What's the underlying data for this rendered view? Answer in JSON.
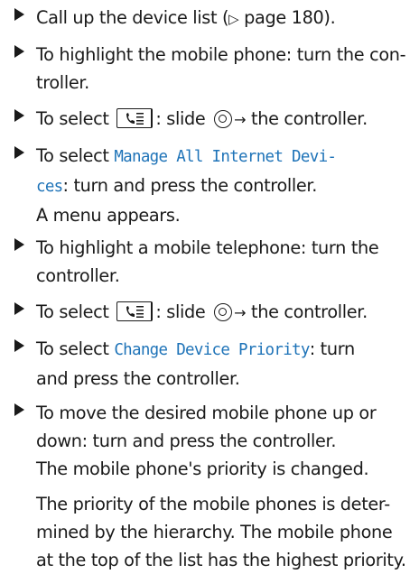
{
  "steps": [
    {
      "a": "Call up the device list (",
      "ref": "▷",
      "b": " page 180)."
    },
    {
      "l1": "To highlight the mobile phone: turn the con-",
      "l2": "troller."
    },
    {
      "a": "To select ",
      "key_icon": "phone-menu-icon",
      "b": ": slide ",
      "arrow": "→",
      "c": " the controller."
    },
    {
      "a": "To select ",
      "m1": "Manage All Internet Devi-",
      "m2": "ces",
      "b": ": turn and press the controller.",
      "c": "A menu appears."
    },
    {
      "l1": "To highlight a mobile telephone: turn the",
      "l2": "controller."
    },
    {
      "a": "To select ",
      "key_icon": "phone-menu-icon",
      "b": ": slide ",
      "arrow": "→",
      "c": " the controller."
    },
    {
      "a": "To select ",
      "m1": "Change Device Priority",
      "b": ": turn",
      "l2": "and press the controller."
    },
    {
      "l1": "To move the desired mobile phone up or",
      "l2": "down: turn and press the controller.",
      "l3": "The mobile phone's priority is changed.",
      "p1": "The priority of the mobile phones is deter-",
      "p2": "mined by the hierarchy. The mobile phone",
      "p3": "at the top of the list has the highest priority."
    }
  ]
}
